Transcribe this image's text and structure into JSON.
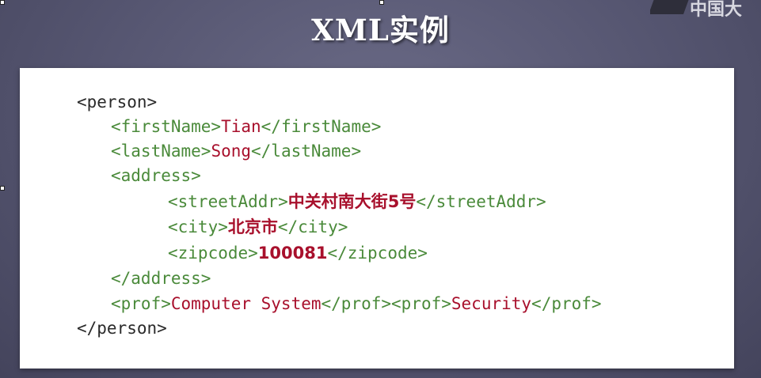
{
  "slide": {
    "title": "XML实例",
    "logo_text": "中国大"
  },
  "xml_lines": [
    {
      "open": "<person>",
      "value": "",
      "close": ""
    },
    {
      "open": "<firstName>",
      "value": "Tian",
      "close": "</firstName>"
    },
    {
      "open": "<lastName>",
      "value": "Song",
      "close": "</lastName>"
    },
    {
      "open": "<address>",
      "value": "",
      "close": ""
    },
    {
      "open": "<streetAddr>",
      "value": "中关村南大街5号",
      "close": "</streetAddr>"
    },
    {
      "open": "<city>",
      "value": "北京市",
      "close": "</city>"
    },
    {
      "open": "<zipcode>",
      "value": "100081",
      "close": "</zipcode>"
    },
    {
      "open": "</address>",
      "value": "",
      "close": ""
    },
    {
      "open": "<prof>",
      "value": "Computer System",
      "close": "</prof>",
      "open2": "<prof>",
      "value2": "Security",
      "close2": "</prof>"
    },
    {
      "open": "</person>",
      "value": "",
      "close": ""
    }
  ],
  "colors": {
    "tag": "#4a8a3a",
    "root_tag": "#2a2a2a",
    "value": "#a8102c",
    "background": "#555570",
    "code_box": "#ffffff"
  }
}
